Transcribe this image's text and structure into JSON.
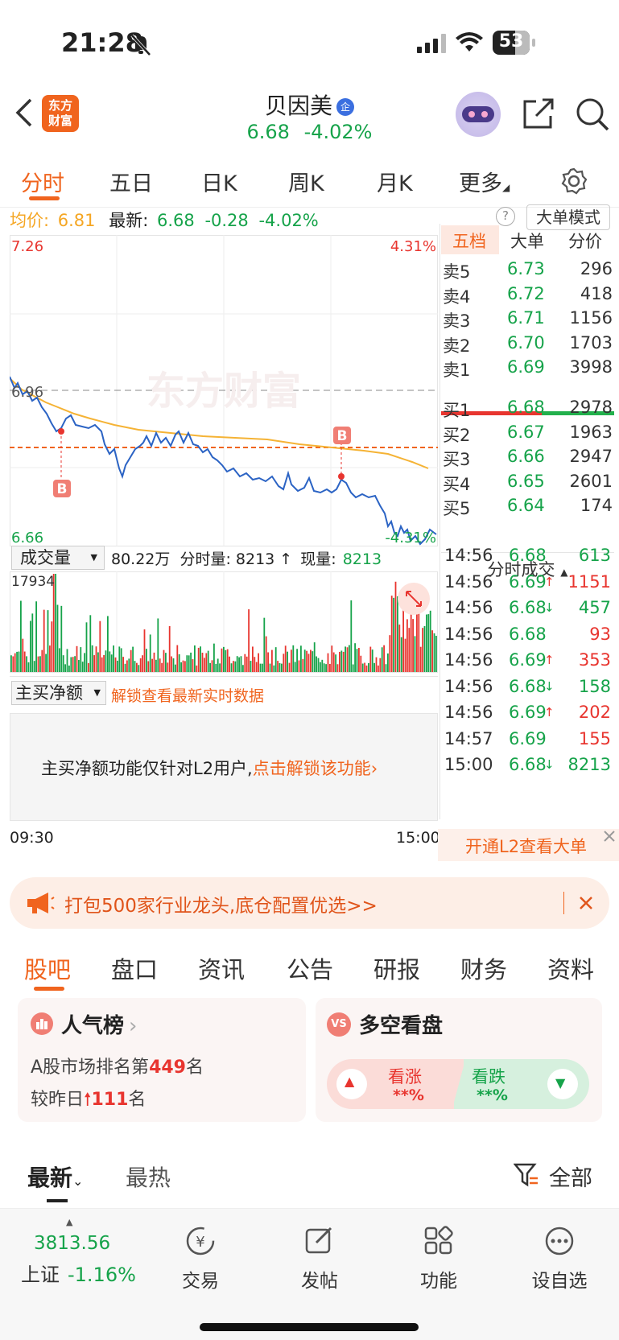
{
  "status": {
    "time": "21:28",
    "battery": "53"
  },
  "header": {
    "stock_name": "贝因美",
    "badge": "企",
    "price": "6.68",
    "change_pct": "-4.02%"
  },
  "tabs": [
    "分时",
    "五日",
    "日K",
    "周K",
    "月K",
    "更多"
  ],
  "info_line": {
    "avg_label": "均价:",
    "avg_val": "6.81",
    "latest_label": "最新:",
    "latest_val": "6.68",
    "chg": "-0.28",
    "pct": "-4.02%",
    "mode_button": "大单模式",
    "help": "?"
  },
  "chart": {
    "y_top": "7.26",
    "y_mid": "6.96",
    "y_bot": "6.66",
    "pct_top": "4.31%",
    "pct_bot": "-4.31%",
    "watermark": "东方财富",
    "marker": "B",
    "time_start": "09:30",
    "time_end": "15:00"
  },
  "volume": {
    "selector": "成交量",
    "total": "80.22万",
    "label_fs": "分时量: 8213",
    "arrow": "↑",
    "label_now": "现量:",
    "now_val": "8213",
    "max": "17934"
  },
  "netbuy": {
    "selector": "主买净额",
    "unlock_link": "解锁查看最新实时数据",
    "notice": "主买净额功能仅针对L2用户,",
    "notice_link": "点击解锁该功能",
    "chevron": "›"
  },
  "book": {
    "tabs": [
      "五档",
      "大单",
      "分价"
    ],
    "asks": [
      {
        "label": "卖5",
        "price": "6.73",
        "vol": "296"
      },
      {
        "label": "卖4",
        "price": "6.72",
        "vol": "418"
      },
      {
        "label": "卖3",
        "price": "6.71",
        "vol": "1156"
      },
      {
        "label": "卖2",
        "price": "6.70",
        "vol": "1703"
      },
      {
        "label": "卖1",
        "price": "6.69",
        "vol": "3998"
      }
    ],
    "bids": [
      {
        "label": "买1",
        "price": "6.68",
        "vol": "2978"
      },
      {
        "label": "买2",
        "price": "6.67",
        "vol": "1963"
      },
      {
        "label": "买3",
        "price": "6.66",
        "vol": "2947"
      },
      {
        "label": "买4",
        "price": "6.65",
        "vol": "2601"
      },
      {
        "label": "买5",
        "price": "6.64",
        "vol": "174"
      }
    ]
  },
  "trades": {
    "title": "分时成交",
    "rows": [
      {
        "t": "14:56",
        "p": "6.68",
        "a": "",
        "v": "613",
        "pc": "green",
        "vc": "green"
      },
      {
        "t": "14:56",
        "p": "6.69",
        "a": "↑",
        "v": "1151",
        "pc": "green",
        "vc": "red"
      },
      {
        "t": "14:56",
        "p": "6.68",
        "a": "↓",
        "v": "457",
        "pc": "green",
        "vc": "green"
      },
      {
        "t": "14:56",
        "p": "6.68",
        "a": "",
        "v": "93",
        "pc": "green",
        "vc": "red"
      },
      {
        "t": "14:56",
        "p": "6.69",
        "a": "↑",
        "v": "353",
        "pc": "green",
        "vc": "red"
      },
      {
        "t": "14:56",
        "p": "6.68",
        "a": "↓",
        "v": "158",
        "pc": "green",
        "vc": "green"
      },
      {
        "t": "14:56",
        "p": "6.69",
        "a": "↑",
        "v": "202",
        "pc": "green",
        "vc": "red"
      },
      {
        "t": "14:57",
        "p": "6.69",
        "a": "",
        "v": "155",
        "pc": "green",
        "vc": "red"
      },
      {
        "t": "15:00",
        "p": "6.68",
        "a": "↓",
        "v": "8213",
        "pc": "green",
        "vc": "green"
      }
    ],
    "l2_link": "开通L2查看大单"
  },
  "banner": {
    "text": "打包500家行业龙头,底仓配置优选>>"
  },
  "section_tabs": [
    "股吧",
    "盘口",
    "资讯",
    "公告",
    "研报",
    "财务",
    "资料"
  ],
  "popularity": {
    "title": "人气榜",
    "rank_prefix": "A股市场排名第",
    "rank": "449",
    "rank_suffix": "名",
    "change_prefix": "较昨日",
    "change": "111",
    "change_suffix": "名"
  },
  "sentiment": {
    "title": "多空看盘",
    "up_label": "看涨",
    "up_val": "**%",
    "down_label": "看跌",
    "down_val": "**%"
  },
  "feed": {
    "tab_latest": "最新",
    "tab_hot": "最热",
    "filter": "全部"
  },
  "bottom": {
    "index_val": "3813.56",
    "index_name": "上证",
    "index_pct": "-1.16%",
    "nav": [
      "交易",
      "发帖",
      "功能",
      "设自选"
    ]
  }
}
